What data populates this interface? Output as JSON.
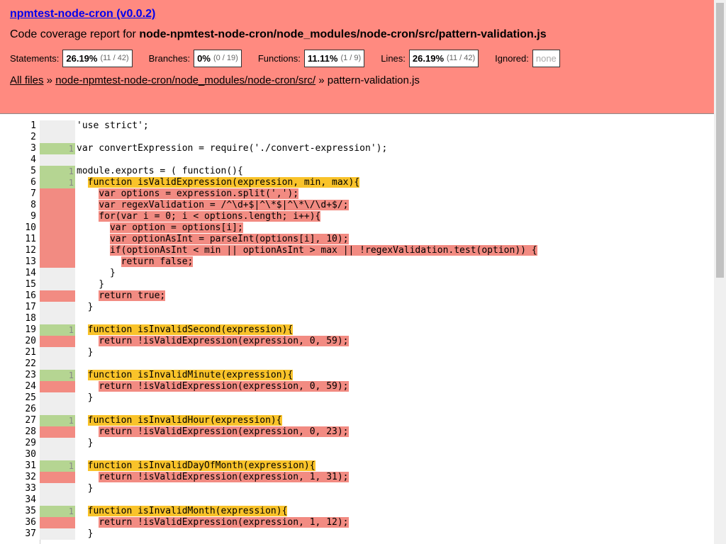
{
  "project": "npmtest-node-cron (v0.0.2)",
  "title_prefix": "Code coverage report for ",
  "file_path": "node-npmtest-node-cron/node_modules/node-cron/src/pattern-validation.js",
  "stats": [
    {
      "label": "Statements:",
      "pct": "26.19%",
      "frac": "(11 / 42)"
    },
    {
      "label": "Branches:",
      "pct": "0%",
      "frac": "(0 / 19)"
    },
    {
      "label": "Functions:",
      "pct": "11.11%",
      "frac": "(1 / 9)"
    },
    {
      "label": "Lines:",
      "pct": "26.19%",
      "frac": "(11 / 42)"
    },
    {
      "label": "Ignored:",
      "none": "none"
    }
  ],
  "breadcrumb": {
    "all_files": "All files",
    "sep1": " » ",
    "dir": "node-npmtest-node-cron/node_modules/node-cron/src/",
    "sep2": " » ",
    "file": "pattern-validation.js"
  },
  "colors": {
    "header": "#ff8a80",
    "covered": "#b5d592",
    "uncovered": "#f28b82",
    "fn_uncovered": "#f9c32a"
  },
  "lines": [
    {
      "n": "1",
      "count": "",
      "cov": "",
      "text": "'use strict';",
      "hl": ""
    },
    {
      "n": "2",
      "count": "",
      "cov": "",
      "text": "",
      "hl": ""
    },
    {
      "n": "3",
      "count": "1",
      "cov": "yes",
      "text": "var convertExpression = require('./convert-expression');",
      "hl": ""
    },
    {
      "n": "4",
      "count": "",
      "cov": "",
      "text": "",
      "hl": ""
    },
    {
      "n": "5",
      "count": "1",
      "cov": "yes",
      "text": "module.exports = ( function(){",
      "hl": ""
    },
    {
      "n": "6",
      "count": "1",
      "cov": "yes",
      "text": "  function isValidExpression(expression, min, max){",
      "hl": "fn"
    },
    {
      "n": "7",
      "count": "",
      "cov": "no",
      "text": "    var options = expression.split(',');",
      "hl": "miss"
    },
    {
      "n": "8",
      "count": "",
      "cov": "no",
      "text": "    var regexValidation = /^\\d+$|^\\*$|^\\*\\/\\d+$/;",
      "hl": "miss"
    },
    {
      "n": "9",
      "count": "",
      "cov": "no",
      "text": "    for(var i = 0; i < options.length; i++){",
      "hl": "miss"
    },
    {
      "n": "10",
      "count": "",
      "cov": "no",
      "text": "      var option = options[i];",
      "hl": "miss"
    },
    {
      "n": "11",
      "count": "",
      "cov": "no",
      "text": "      var optionAsInt = parseInt(options[i], 10);",
      "hl": "miss"
    },
    {
      "n": "12",
      "count": "",
      "cov": "no",
      "text": "      if(optionAsInt < min || optionAsInt > max || !regexValidation.test(option)) {",
      "hl": "miss"
    },
    {
      "n": "13",
      "count": "",
      "cov": "no",
      "text": "        return false;",
      "hl": "miss"
    },
    {
      "n": "14",
      "count": "",
      "cov": "",
      "text": "      }",
      "hl": ""
    },
    {
      "n": "15",
      "count": "",
      "cov": "",
      "text": "    }",
      "hl": ""
    },
    {
      "n": "16",
      "count": "",
      "cov": "no",
      "text": "    return true;",
      "hl": "miss"
    },
    {
      "n": "17",
      "count": "",
      "cov": "",
      "text": "  }",
      "hl": ""
    },
    {
      "n": "18",
      "count": "",
      "cov": "",
      "text": "",
      "hl": ""
    },
    {
      "n": "19",
      "count": "1",
      "cov": "yes",
      "text": "  function isInvalidSecond(expression){",
      "hl": "fn"
    },
    {
      "n": "20",
      "count": "",
      "cov": "no",
      "text": "    return !isValidExpression(expression, 0, 59);",
      "hl": "miss"
    },
    {
      "n": "21",
      "count": "",
      "cov": "",
      "text": "  }",
      "hl": ""
    },
    {
      "n": "22",
      "count": "",
      "cov": "",
      "text": "",
      "hl": ""
    },
    {
      "n": "23",
      "count": "1",
      "cov": "yes",
      "text": "  function isInvalidMinute(expression){",
      "hl": "fn"
    },
    {
      "n": "24",
      "count": "",
      "cov": "no",
      "text": "    return !isValidExpression(expression, 0, 59);",
      "hl": "miss"
    },
    {
      "n": "25",
      "count": "",
      "cov": "",
      "text": "  }",
      "hl": ""
    },
    {
      "n": "26",
      "count": "",
      "cov": "",
      "text": "",
      "hl": ""
    },
    {
      "n": "27",
      "count": "1",
      "cov": "yes",
      "text": "  function isInvalidHour(expression){",
      "hl": "fn"
    },
    {
      "n": "28",
      "count": "",
      "cov": "no",
      "text": "    return !isValidExpression(expression, 0, 23);",
      "hl": "miss"
    },
    {
      "n": "29",
      "count": "",
      "cov": "",
      "text": "  }",
      "hl": ""
    },
    {
      "n": "30",
      "count": "",
      "cov": "",
      "text": "",
      "hl": ""
    },
    {
      "n": "31",
      "count": "1",
      "cov": "yes",
      "text": "  function isInvalidDayOfMonth(expression){",
      "hl": "fn"
    },
    {
      "n": "32",
      "count": "",
      "cov": "no",
      "text": "    return !isValidExpression(expression, 1, 31);",
      "hl": "miss"
    },
    {
      "n": "33",
      "count": "",
      "cov": "",
      "text": "  }",
      "hl": ""
    },
    {
      "n": "34",
      "count": "",
      "cov": "",
      "text": "",
      "hl": ""
    },
    {
      "n": "35",
      "count": "1",
      "cov": "yes",
      "text": "  function isInvalidMonth(expression){",
      "hl": "fn"
    },
    {
      "n": "36",
      "count": "",
      "cov": "no",
      "text": "    return !isValidExpression(expression, 1, 12);",
      "hl": "miss"
    },
    {
      "n": "37",
      "count": "",
      "cov": "",
      "text": "  }",
      "hl": ""
    }
  ]
}
